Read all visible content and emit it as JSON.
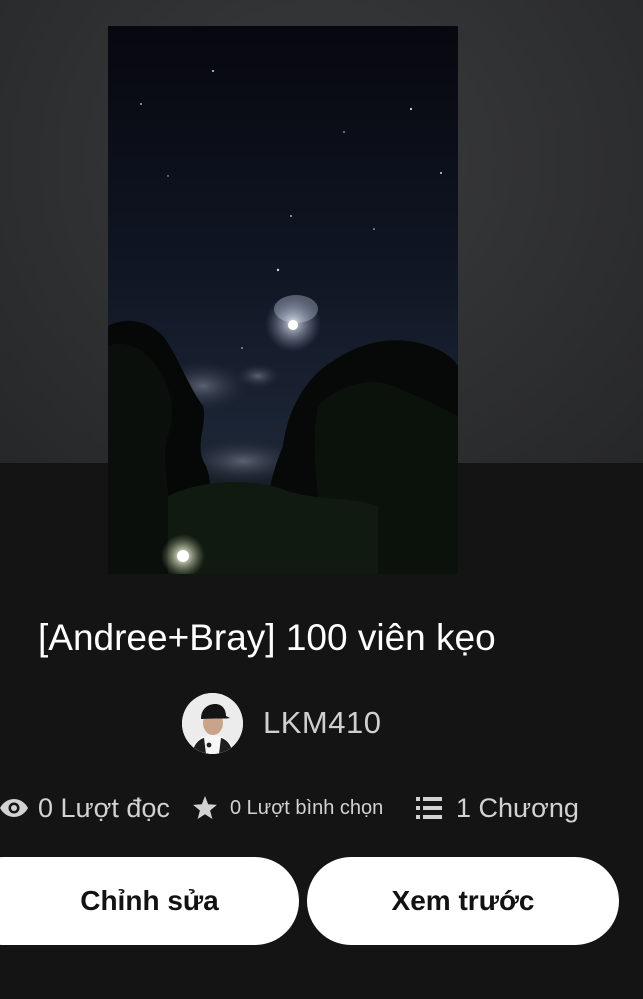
{
  "story": {
    "title": "[Andree+Bray] 100 viên kẹo",
    "author": "LKM410"
  },
  "stats": {
    "reads": "0 Lượt đọc",
    "votes": "0 Lượt bình chọn",
    "chapters": "1 Chương"
  },
  "actions": {
    "edit_label": "Chỉnh sửa",
    "preview_label": "Xem trước"
  },
  "icons": {
    "reads": "eye-icon",
    "votes": "star-icon",
    "chapters": "list-icon"
  },
  "colors": {
    "background": "#141414",
    "header_background": "#2f3032",
    "button_background": "#ffffff",
    "text_primary": "#ffffff",
    "text_secondary": "#d2d2d2"
  }
}
